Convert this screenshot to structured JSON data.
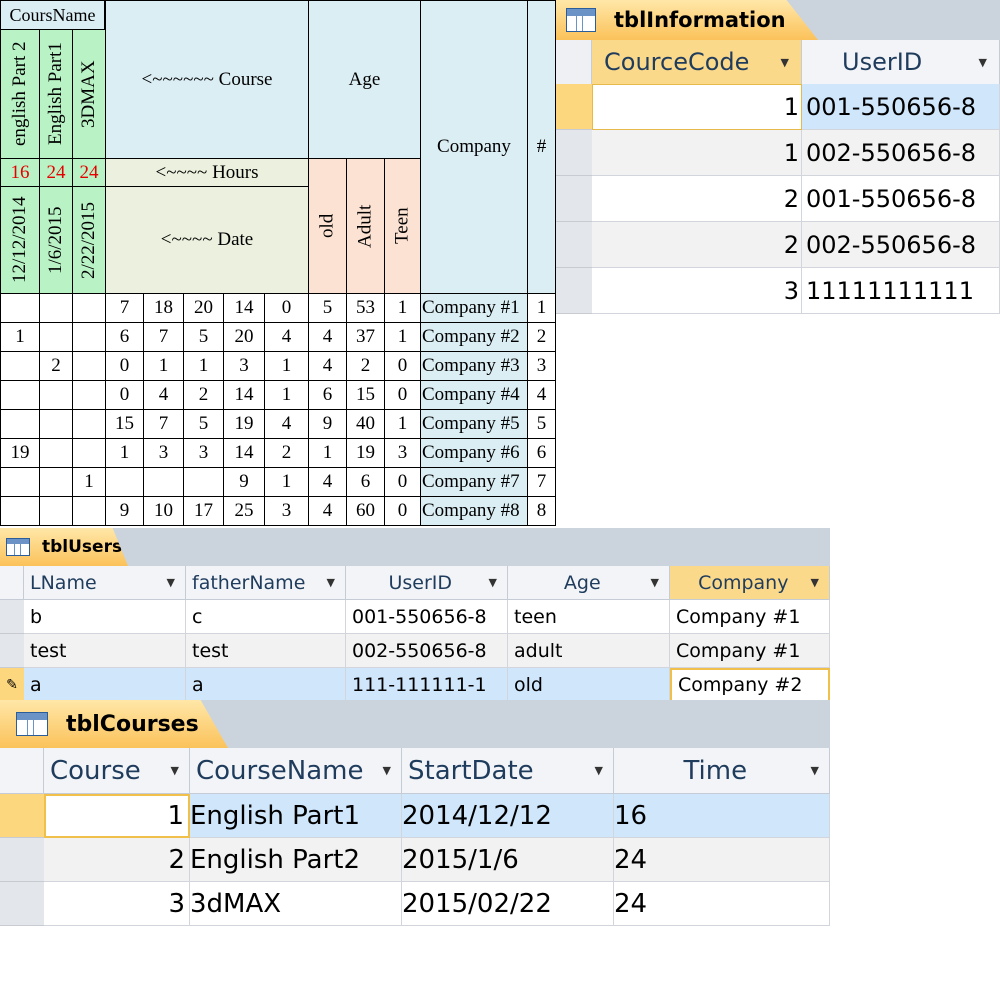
{
  "pivot_sheet": {
    "header": {
      "course_name": "CoursName",
      "courses": [
        "english Part 2",
        "English Part1",
        "3DMAX"
      ],
      "hours": [
        "16",
        "24",
        "24"
      ],
      "dates": [
        "12/12/2014",
        "1/6/2015",
        "2/22/2015"
      ],
      "course_arrow": "<~~~~~~ Course",
      "hours_arrow": "<~~~~ Hours",
      "date_arrow": "<~~~~ Date",
      "age": "Age",
      "age_groups": [
        "old",
        "Adult",
        "Teen"
      ],
      "company": "Company",
      "hash": "#"
    },
    "rows": [
      {
        "c": [
          "",
          "",
          ""
        ],
        "n": [
          "7",
          "18",
          "20",
          "14",
          "0",
          "5",
          "53",
          "1"
        ],
        "company": "Company #1",
        "id": "1"
      },
      {
        "c": [
          "1",
          "",
          ""
        ],
        "n": [
          "6",
          "7",
          "5",
          "20",
          "4",
          "4",
          "37",
          "1"
        ],
        "company": "Company #2",
        "id": "2"
      },
      {
        "c": [
          "",
          "2",
          ""
        ],
        "n": [
          "0",
          "1",
          "1",
          "3",
          "1",
          "4",
          "2",
          "0"
        ],
        "company": "Company #3",
        "id": "3"
      },
      {
        "c": [
          "",
          "",
          ""
        ],
        "n": [
          "0",
          "4",
          "2",
          "14",
          "1",
          "6",
          "15",
          "0"
        ],
        "company": "Company #4",
        "id": "4"
      },
      {
        "c": [
          "",
          "",
          ""
        ],
        "n": [
          "15",
          "7",
          "5",
          "19",
          "4",
          "9",
          "40",
          "1"
        ],
        "company": "Company #5",
        "id": "5"
      },
      {
        "c": [
          "19",
          "",
          ""
        ],
        "n": [
          "1",
          "3",
          "3",
          "14",
          "2",
          "1",
          "19",
          "3"
        ],
        "company": "Company #6",
        "id": "6"
      },
      {
        "c": [
          "",
          "",
          "1"
        ],
        "n": [
          "",
          "",
          "",
          "9",
          "1",
          "4",
          "6",
          "0"
        ],
        "company": "Company #7",
        "id": "7"
      },
      {
        "c": [
          "",
          "",
          ""
        ],
        "n": [
          "9",
          "10",
          "17",
          "25",
          "3",
          "4",
          "60",
          "0"
        ],
        "company": "Company #8",
        "id": "8"
      }
    ]
  },
  "tblInformation": {
    "title": "tblInformation",
    "columns": [
      "CourceCode",
      "UserID"
    ],
    "rows": [
      {
        "code": "1",
        "user": "001-550656-8"
      },
      {
        "code": "1",
        "user": "002-550656-8"
      },
      {
        "code": "2",
        "user": "001-550656-8"
      },
      {
        "code": "2",
        "user": "002-550656-8"
      },
      {
        "code": "3",
        "user": "11111111111"
      }
    ]
  },
  "tblUsers": {
    "title": "tblUsers",
    "columns": [
      "LName",
      "fatherName",
      "UserID",
      "Age",
      "Company"
    ],
    "rows": [
      [
        "b",
        "c",
        "001-550656-8",
        "teen",
        "Company #1"
      ],
      [
        "test",
        "test",
        "002-550656-8",
        "adult",
        "Company #1"
      ],
      [
        "a",
        "a",
        "111-111111-1",
        "old",
        "Company #2"
      ]
    ]
  },
  "tblCourses": {
    "title": "tblCourses",
    "columns": [
      "Course",
      "CourseName",
      "StartDate",
      "Time"
    ],
    "rows": [
      [
        "1",
        "English Part1",
        "2014/12/12",
        "16"
      ],
      [
        "2",
        "English Part2",
        "2015/1/6",
        "24"
      ],
      [
        "3",
        "3dMAX",
        "2015/02/22",
        "24"
      ]
    ]
  },
  "icons": {
    "table": "table-icon",
    "dropdown": "dropdown-arrow-icon",
    "edit": "pencil-icon"
  },
  "colors": {
    "tab_active": "#fbc25a",
    "selected_row": "#cfe6fb",
    "hours_red": "#e60000",
    "header_blue": "#dbeef4"
  }
}
